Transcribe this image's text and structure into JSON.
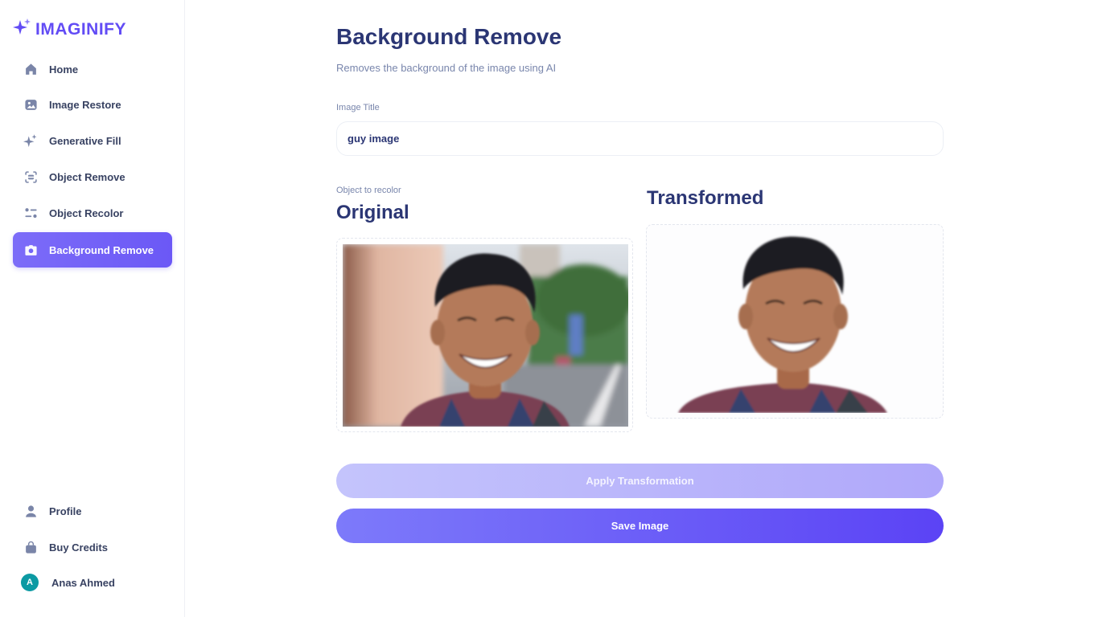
{
  "app": {
    "name": "IMAGINIFY",
    "accent": "#624cf5"
  },
  "sidebar": {
    "items": [
      {
        "label": "Home",
        "icon": "home-icon"
      },
      {
        "label": "Image Restore",
        "icon": "image-icon"
      },
      {
        "label": "Generative Fill",
        "icon": "stars-icon"
      },
      {
        "label": "Object Remove",
        "icon": "scan-icon"
      },
      {
        "label": "Object Recolor",
        "icon": "filter-icon"
      },
      {
        "label": "Background Remove",
        "icon": "camera-icon",
        "active": true
      }
    ],
    "bottom": [
      {
        "label": "Profile",
        "icon": "user-icon"
      },
      {
        "label": "Buy Credits",
        "icon": "bag-icon"
      }
    ],
    "user": {
      "initial": "A",
      "name": "Anas Ahmed"
    }
  },
  "page": {
    "title": "Background Remove",
    "subtitle": "Removes the background of the image using AI"
  },
  "form": {
    "title_label": "Image Title",
    "title_value": "guy image",
    "recolor_label": "Object to recolor"
  },
  "images": {
    "original_title": "Original",
    "transformed_title": "Transformed"
  },
  "actions": {
    "apply_label": "Apply Transformation",
    "save_label": "Save Image"
  }
}
